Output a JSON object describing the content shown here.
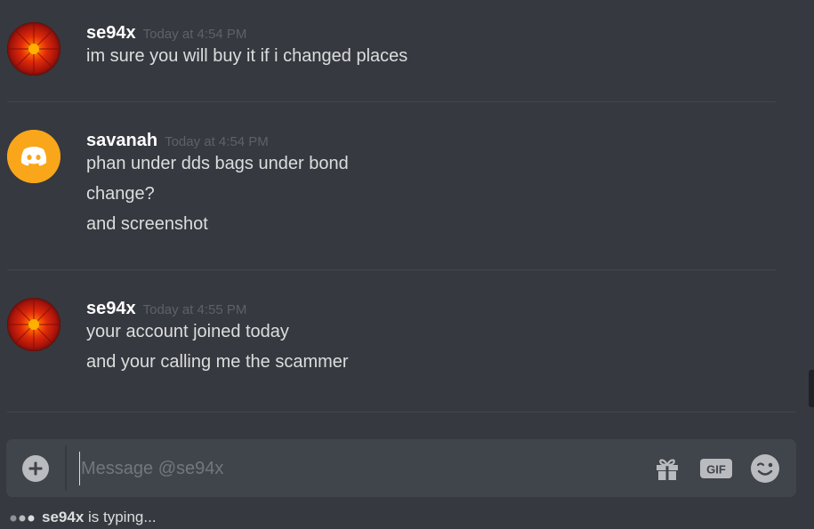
{
  "messages": [
    {
      "author": "se94x",
      "timestamp": "Today at 4:54 PM",
      "avatar": "red-flower-avatar",
      "lines": [
        "im sure you will buy it if i changed places"
      ]
    },
    {
      "author": "savanah",
      "timestamp": "Today at 4:54 PM",
      "avatar": "discord-default-avatar",
      "avatar_color": "#faa61a",
      "lines": [
        "phan under dds bags under bond",
        "change?",
        "and screenshot"
      ]
    },
    {
      "author": "se94x",
      "timestamp": "Today at 4:55 PM",
      "avatar": "red-flower-avatar",
      "lines": [
        "your account joined today",
        "and your calling me the scammer"
      ]
    }
  ],
  "composer": {
    "placeholder": "Message @se94x",
    "icons": [
      "add-icon",
      "gift-icon",
      "gif-icon",
      "emoji-icon"
    ]
  },
  "typing": {
    "user": "se94x",
    "text": " is typing..."
  },
  "colors": {
    "background": "#36393f",
    "composer": "#40444b",
    "author": "#ffffff",
    "message_text": "#dcddde",
    "timestamp": "#72767d"
  }
}
